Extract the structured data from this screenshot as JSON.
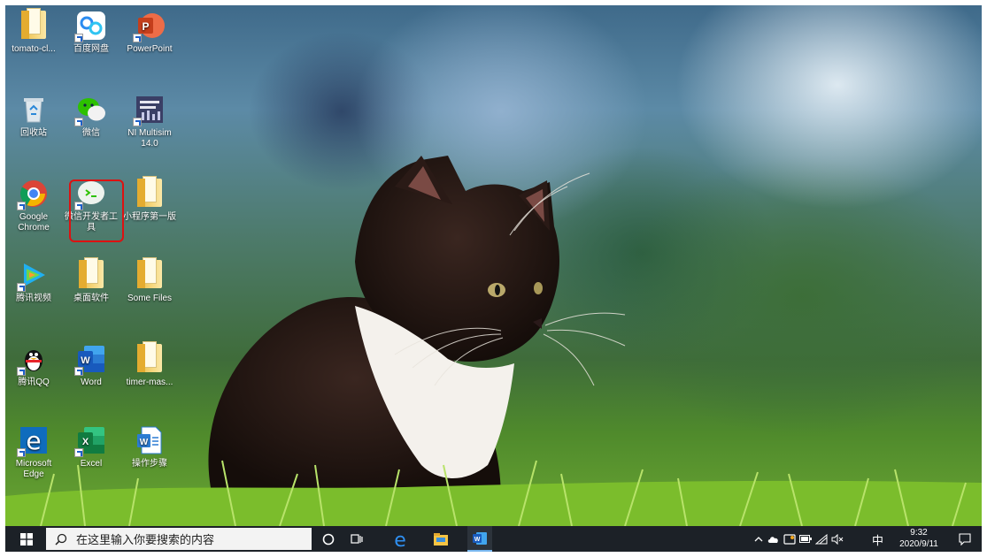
{
  "desktop": {
    "icons": [
      {
        "id": "tomato",
        "label": "tomato-cl...",
        "icon": "folder-icon"
      },
      {
        "id": "baidu",
        "label": "百度网盘",
        "icon": "baidu-netdisk-icon"
      },
      {
        "id": "ppt",
        "label": "PowerPoint",
        "icon": "powerpoint-icon"
      },
      {
        "id": "recycle",
        "label": "回收站",
        "icon": "recycle-bin-icon"
      },
      {
        "id": "wechat",
        "label": "微信",
        "icon": "wechat-icon"
      },
      {
        "id": "multisim",
        "label": "NI Multisim 14.0",
        "icon": "multisim-icon"
      },
      {
        "id": "chrome",
        "label": "Google Chrome",
        "icon": "chrome-icon"
      },
      {
        "id": "wxdev",
        "label": "微信开发者工具",
        "icon": "wechat-devtools-icon"
      },
      {
        "id": "miniprog",
        "label": "小程序第一版",
        "icon": "folder-icon"
      },
      {
        "id": "tencentvideo",
        "label": "腾讯视频",
        "icon": "tencent-video-icon"
      },
      {
        "id": "deskapps",
        "label": "桌面软件",
        "icon": "folder-icon"
      },
      {
        "id": "somefiles",
        "label": "Some Files",
        "icon": "folder-icon"
      },
      {
        "id": "qq",
        "label": "腾讯QQ",
        "icon": "qq-penguin-icon"
      },
      {
        "id": "word",
        "label": "Word",
        "icon": "word-icon"
      },
      {
        "id": "timer",
        "label": "timer-mas...",
        "icon": "folder-icon"
      },
      {
        "id": "edge",
        "label": "Microsoft Edge",
        "icon": "edge-icon"
      },
      {
        "id": "excel",
        "label": "Excel",
        "icon": "excel-icon"
      },
      {
        "id": "opsteps",
        "label": "操作步骤",
        "icon": "word-document-icon"
      }
    ]
  },
  "taskbar": {
    "search_placeholder": "在这里输入你要搜索的内容",
    "ime": "中",
    "time": "9:32",
    "date": "2020/9/11"
  },
  "colors": {
    "taskbar_bg": "#1c2127",
    "selection_border": "#dd1111"
  }
}
